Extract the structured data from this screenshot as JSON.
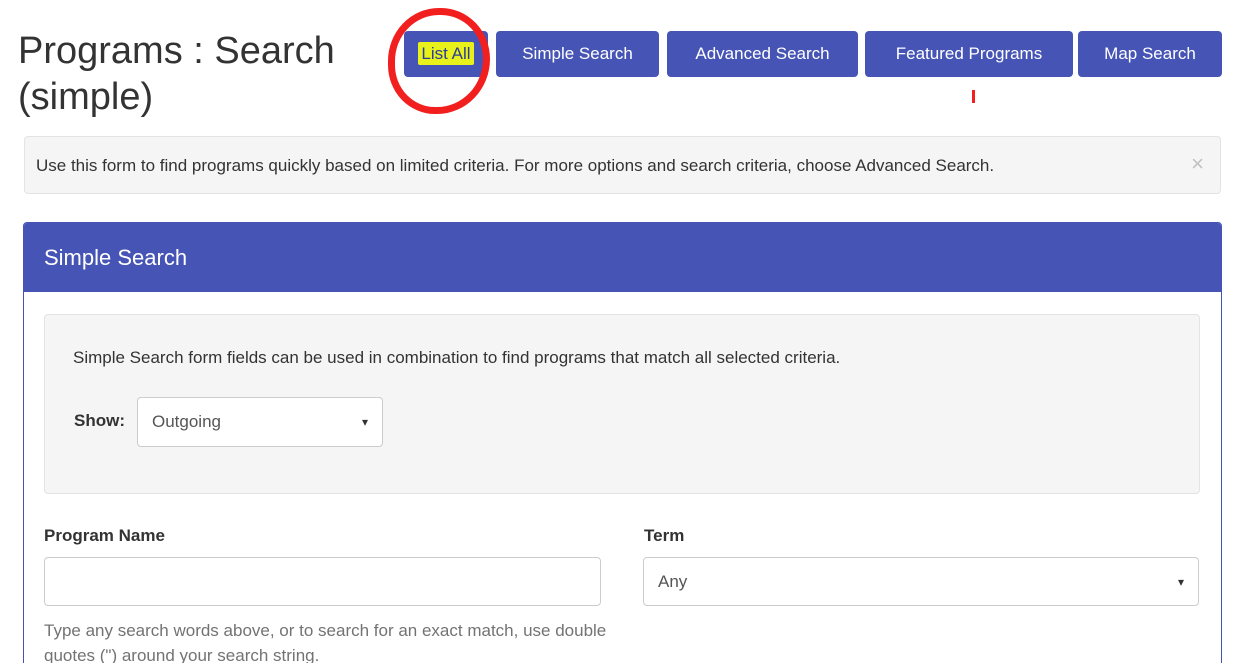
{
  "header": {
    "title": "Programs : Search (simple)"
  },
  "nav": {
    "list_all": "List All",
    "simple_search": "Simple Search",
    "advanced_search": "Advanced Search",
    "featured_programs": "Featured Programs",
    "map_search": "Map Search"
  },
  "alert": {
    "text": "Use this form to find programs quickly based on limited criteria. For more options and search criteria, choose Advanced Search.",
    "close": "×"
  },
  "panel": {
    "title": "Simple Search",
    "criteria_text": "Simple Search form fields can be used in combination to find programs that match all selected criteria.",
    "show_label": "Show:",
    "show_value": "Outgoing",
    "program_name_label": "Program Name",
    "program_name_value": "",
    "program_name_placeholder": "",
    "term_label": "Term",
    "term_value": "Any",
    "help_text": "Type any search words above, or to search for an exact match, use double quotes (\") around your search string."
  },
  "icons": {
    "select_caret": "▾"
  },
  "colors": {
    "primary": "#4654b5",
    "highlight": "#e8f21a",
    "annotation": "#f21f1f"
  }
}
